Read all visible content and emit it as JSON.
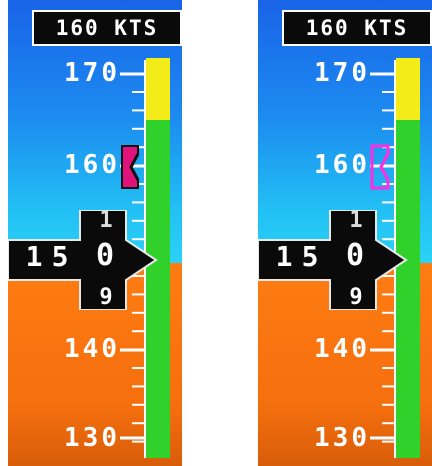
{
  "instruments": [
    {
      "name": "airspeed-tape-left",
      "target_speed": "160 KTS",
      "scale_labels": [
        "170",
        "160",
        "140",
        "130"
      ],
      "readout": {
        "hundreds": "1",
        "tens": "5",
        "ones_above": "1",
        "ones": "0",
        "ones_below": "9"
      },
      "speed_bug": {
        "value": 160,
        "style": "filled",
        "color": "#e0137a"
      }
    },
    {
      "name": "airspeed-tape-right",
      "target_speed": "160 KTS",
      "scale_labels": [
        "170",
        "160",
        "140",
        "130"
      ],
      "readout": {
        "hundreds": "1",
        "tens": "5",
        "ones_above": "1",
        "ones": "0",
        "ones_below": "9"
      },
      "speed_bug": {
        "value": 160,
        "style": "outline",
        "color": "#ff2de0"
      }
    }
  ],
  "colors": {
    "sky": "#1c8cf0",
    "ground": "#ff7c12",
    "caution_band": "#f4ec19",
    "normal_band": "#2fd12a",
    "readout_background": "#0a0a0a"
  }
}
